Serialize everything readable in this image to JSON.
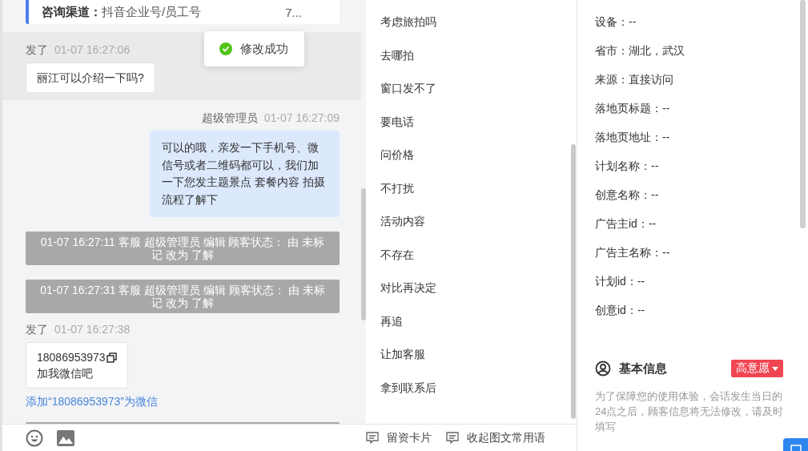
{
  "toasts": [
    {
      "text": "修改成功"
    }
  ],
  "channel_card": {
    "label": "咨询渠道：",
    "value": "抖音企业号/员工号",
    "tail": "7..."
  },
  "messages": [
    {
      "kind": "incoming",
      "highlighted": true,
      "sender": "发了",
      "time": "01-07 16:27:06",
      "text": "丽江可以介绍一下吗?"
    },
    {
      "kind": "outgoing",
      "sender": "超级管理员",
      "time": "01-07 16:27:09",
      "text": "可以的哦，亲发一下手机号、微信号或者二维码都可以，我们加一下您发主题景点 套餐内容 拍摄流程了解下"
    },
    {
      "kind": "system",
      "text": "01-07 16:27:11 客服 超级管理员 编辑 顾客状态： 由 未标记 改为 了解"
    },
    {
      "kind": "system",
      "text": "01-07 16:27:31 客服 超级管理员 编辑 顾客状态： 由 未标记 改为 了解"
    },
    {
      "kind": "contact",
      "highlighted": false,
      "sender": "发了",
      "time": "01-07 16:27:38",
      "phone": "18086953973",
      "text": "加我微信吧",
      "link": "添加“18086953973”为微信"
    },
    {
      "kind": "cut"
    }
  ],
  "phrases": [
    "考虑旅拍吗",
    "去哪拍",
    "窗口发不了",
    "要电话",
    "问价格",
    "不打扰",
    "活动内容",
    "不存在",
    "对比再决定",
    "再追",
    "让加客服",
    "拿到联系后"
  ],
  "phrase_actions": [
    {
      "label": "留资卡片"
    },
    {
      "label": "收起图文常用语"
    }
  ],
  "source_info": {
    "fields": [
      {
        "text": "设备：--"
      },
      {
        "text": "省市：湖北，武汉"
      },
      {
        "text": "来源：直接访问"
      },
      {
        "text": "落地页标题：--"
      },
      {
        "text": "落地页地址：--"
      },
      {
        "text": "计划名称：--"
      },
      {
        "text": "创意名称：--"
      },
      {
        "text": "广告主id：--"
      },
      {
        "text": "广告主名称：--"
      },
      {
        "text": "计划id：--"
      },
      {
        "text": "创意id：--"
      }
    ]
  },
  "basic_info": {
    "title": "基本信息",
    "intent": "高意愿",
    "notice": "为了保障您的使用体验，会话发生当日的24点之后，顾客信息将无法修改，请及时填写"
  }
}
